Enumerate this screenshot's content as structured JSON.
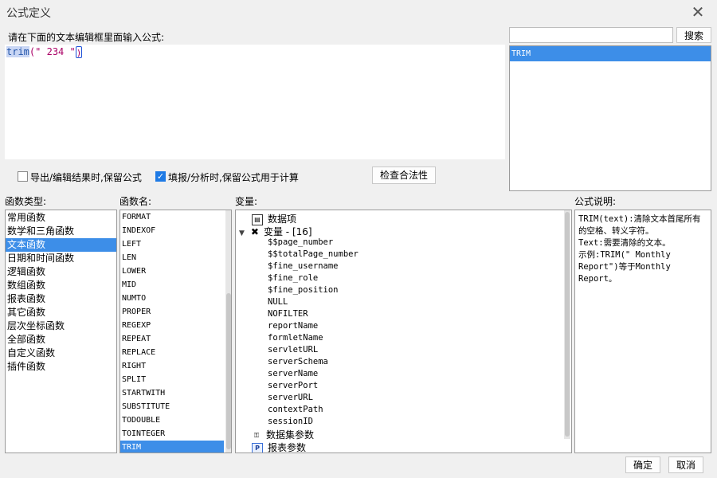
{
  "window": {
    "title": "公式定义"
  },
  "editor": {
    "instruction": "请在下面的文本编辑框里面输入公式:",
    "code": {
      "func": "trim",
      "open": "(",
      "string": "\" 234 \"",
      "close": ")"
    }
  },
  "search": {
    "placeholder": "",
    "button_label": "搜索",
    "results": [
      "TRIM"
    ]
  },
  "options": {
    "export_keep": {
      "label": "导出/编辑结果时,保留公式",
      "checked": false
    },
    "fill_keep": {
      "label": "填报/分析时,保留公式用于计算",
      "checked": true
    },
    "check_button": "检查合法性"
  },
  "categories": {
    "label": "函数类型:",
    "items": [
      "常用函数",
      "数学和三角函数",
      "文本函数",
      "日期和时间函数",
      "逻辑函数",
      "数组函数",
      "报表函数",
      "其它函数",
      "层次坐标函数",
      "全部函数",
      "自定义函数",
      "插件函数"
    ],
    "selected": "文本函数"
  },
  "functions": {
    "label": "函数名:",
    "items": [
      "FORMAT",
      "INDEXOF",
      "LEFT",
      "LEN",
      "LOWER",
      "MID",
      "NUMTO",
      "PROPER",
      "REGEXP",
      "REPEAT",
      "REPLACE",
      "RIGHT",
      "SPLIT",
      "STARTWITH",
      "SUBSTITUTE",
      "TODOUBLE",
      "TOINTEGER",
      "TRIM"
    ],
    "selected": "TRIM"
  },
  "variables": {
    "label": "变量:",
    "data_items": "数据项",
    "var_group": "变量 - [16]",
    "vars": [
      "$$page_number",
      "$$totalPage_number",
      "$fine_username",
      "$fine_role",
      "$fine_position",
      "NULL",
      "NOFILTER",
      "reportName",
      "formletName",
      "servletURL",
      "serverSchema",
      "serverName",
      "serverPort",
      "serverURL",
      "contextPath",
      "sessionID"
    ],
    "dataset_params": "数据集参数",
    "report_params": "报表参数"
  },
  "description": {
    "label": "公式说明:",
    "lines": [
      "TRIM(text):清除文本首尾所有",
      "的空格、转义字符。",
      "Text:需要清除的文本。",
      "示例:TRIM(\" Monthly",
      "Report\")等于Monthly",
      "Report。"
    ]
  },
  "footer": {
    "ok": "确定",
    "cancel": "取消"
  }
}
